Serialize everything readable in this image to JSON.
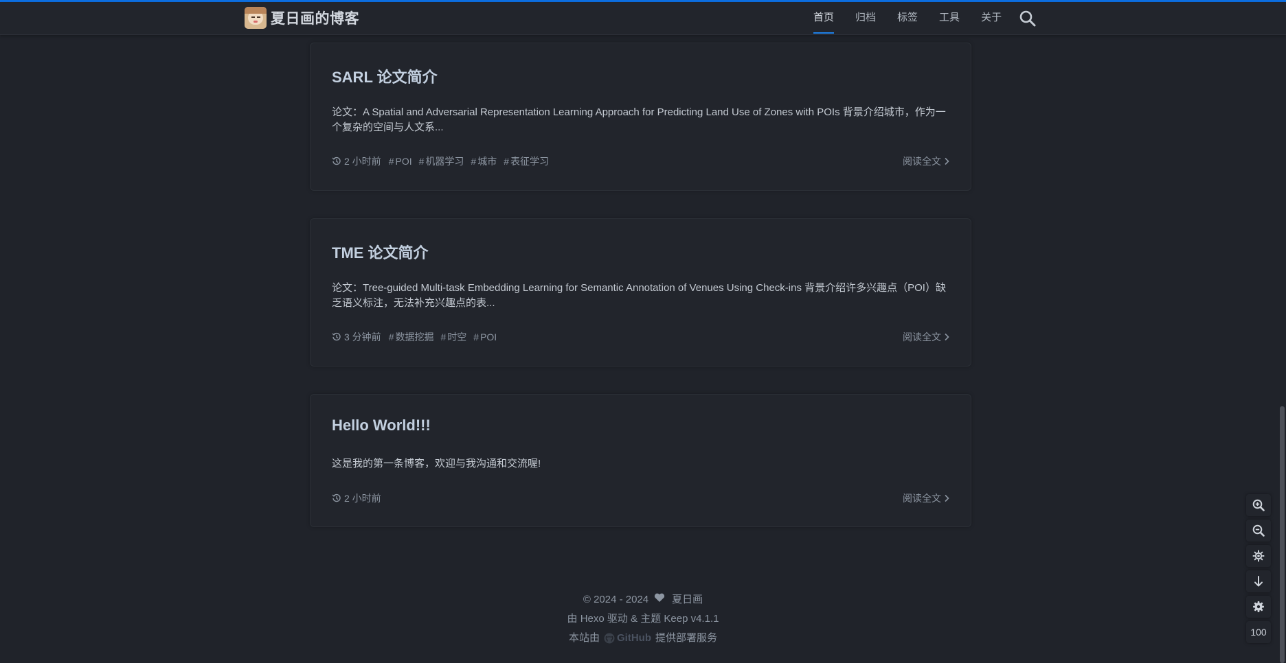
{
  "site": {
    "title": "夏日画的博客"
  },
  "nav": {
    "items": [
      "首页",
      "归档",
      "标签",
      "工具",
      "关于"
    ]
  },
  "posts": [
    {
      "title": "SARL 论文简介",
      "excerpt": "论文：A Spatial and Adversarial Representation Learning Approach for Predicting Land Use of Zones with POIs 背景介绍城市，作为一个复杂的空间与人文系...",
      "time": "2 小时前",
      "tags": [
        "POI",
        "机器学习",
        "城市",
        "表征学习"
      ],
      "read_more": "阅读全文"
    },
    {
      "title": "TME 论文简介",
      "excerpt": "论文：Tree-guided Multi-task Embedding Learning for Semantic Annotation of Venues Using Check-ins 背景介绍许多兴趣点（POI）缺乏语义标注，无法补充兴趣点的表...",
      "time": "3 分钟前",
      "tags": [
        "数据挖掘",
        "时空",
        "POI"
      ],
      "read_more": "阅读全文"
    },
    {
      "title": "Hello World!!!",
      "excerpt": "这是我的第一条博客，欢迎与我沟通和交流喔!",
      "time": "2 小时前",
      "tags": [],
      "read_more": "阅读全文"
    }
  ],
  "footer": {
    "copyright": "© 2024 - 2024",
    "author": "夏日画",
    "powered": "由 Hexo 驱动 & 主题 Keep v4.1.1",
    "hosted_prefix": "本站由",
    "hosted_brand": "GitHub",
    "hosted_suffix": "提供部署服务"
  },
  "tools": {
    "zoom_percent": "100"
  },
  "colors": {
    "accent": "#1e80e8",
    "background": "#20232a",
    "card": "#22252c"
  }
}
